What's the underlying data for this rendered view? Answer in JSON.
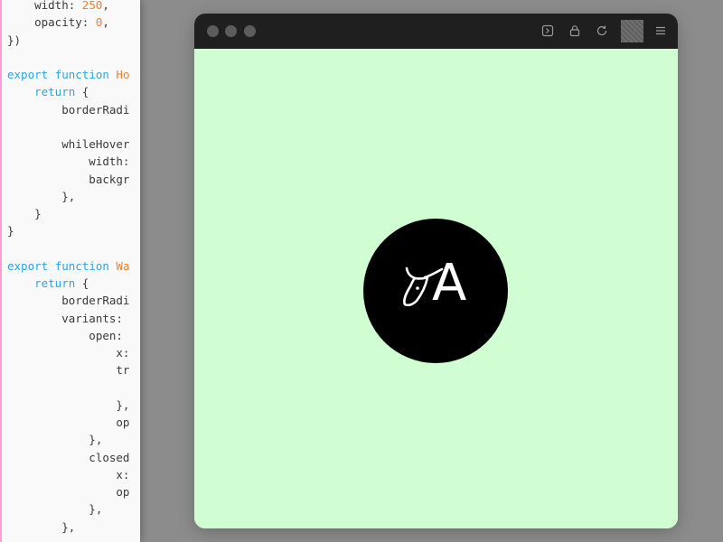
{
  "editor": {
    "lines": [
      [
        {
          "t": "    width: ",
          "c": ""
        },
        {
          "t": "250",
          "c": "num"
        },
        {
          "t": ",",
          "c": ""
        }
      ],
      [
        {
          "t": "    opacity: ",
          "c": ""
        },
        {
          "t": "0",
          "c": "num"
        },
        {
          "t": ",",
          "c": ""
        }
      ],
      [
        {
          "t": "})",
          "c": ""
        }
      ],
      [],
      [
        {
          "t": "export ",
          "c": "kw"
        },
        {
          "t": "function ",
          "c": "kw"
        },
        {
          "t": "Ho",
          "c": "fn"
        }
      ],
      [
        {
          "t": "    ",
          "c": ""
        },
        {
          "t": "return",
          "c": "kw"
        },
        {
          "t": " {",
          "c": ""
        }
      ],
      [
        {
          "t": "        borderRadi",
          "c": ""
        }
      ],
      [],
      [
        {
          "t": "        whileHover",
          "c": ""
        }
      ],
      [
        {
          "t": "            width:",
          "c": ""
        }
      ],
      [
        {
          "t": "            backgr",
          "c": ""
        }
      ],
      [
        {
          "t": "        },",
          "c": ""
        }
      ],
      [
        {
          "t": "    }",
          "c": ""
        }
      ],
      [
        {
          "t": "}",
          "c": ""
        }
      ],
      [],
      [
        {
          "t": "export ",
          "c": "kw"
        },
        {
          "t": "function ",
          "c": "kw"
        },
        {
          "t": "Wa",
          "c": "fn"
        }
      ],
      [
        {
          "t": "    ",
          "c": ""
        },
        {
          "t": "return",
          "c": "kw"
        },
        {
          "t": " {",
          "c": ""
        }
      ],
      [
        {
          "t": "        borderRadi",
          "c": ""
        }
      ],
      [
        {
          "t": "        variants:",
          "c": ""
        }
      ],
      [
        {
          "t": "            open:",
          "c": ""
        }
      ],
      [
        {
          "t": "                x:",
          "c": ""
        }
      ],
      [
        {
          "t": "                tr",
          "c": ""
        }
      ],
      [],
      [
        {
          "t": "                },",
          "c": ""
        }
      ],
      [
        {
          "t": "                op",
          "c": ""
        }
      ],
      [
        {
          "t": "            },",
          "c": ""
        }
      ],
      [
        {
          "t": "            closed",
          "c": ""
        }
      ],
      [
        {
          "t": "                x:",
          "c": ""
        }
      ],
      [
        {
          "t": "                op",
          "c": ""
        }
      ],
      [
        {
          "t": "            },",
          "c": ""
        }
      ],
      [
        {
          "t": "        },",
          "c": ""
        }
      ],
      [
        {
          "t": "        ",
          "c": ""
        }
      ]
    ]
  },
  "preview": {
    "logo_letter": "A",
    "background_color": "#d1fdd3",
    "circle_color": "#000000"
  },
  "titlebar": {
    "icons": [
      "terminal-icon",
      "lock-icon",
      "refresh-icon",
      "menu-icon"
    ]
  }
}
